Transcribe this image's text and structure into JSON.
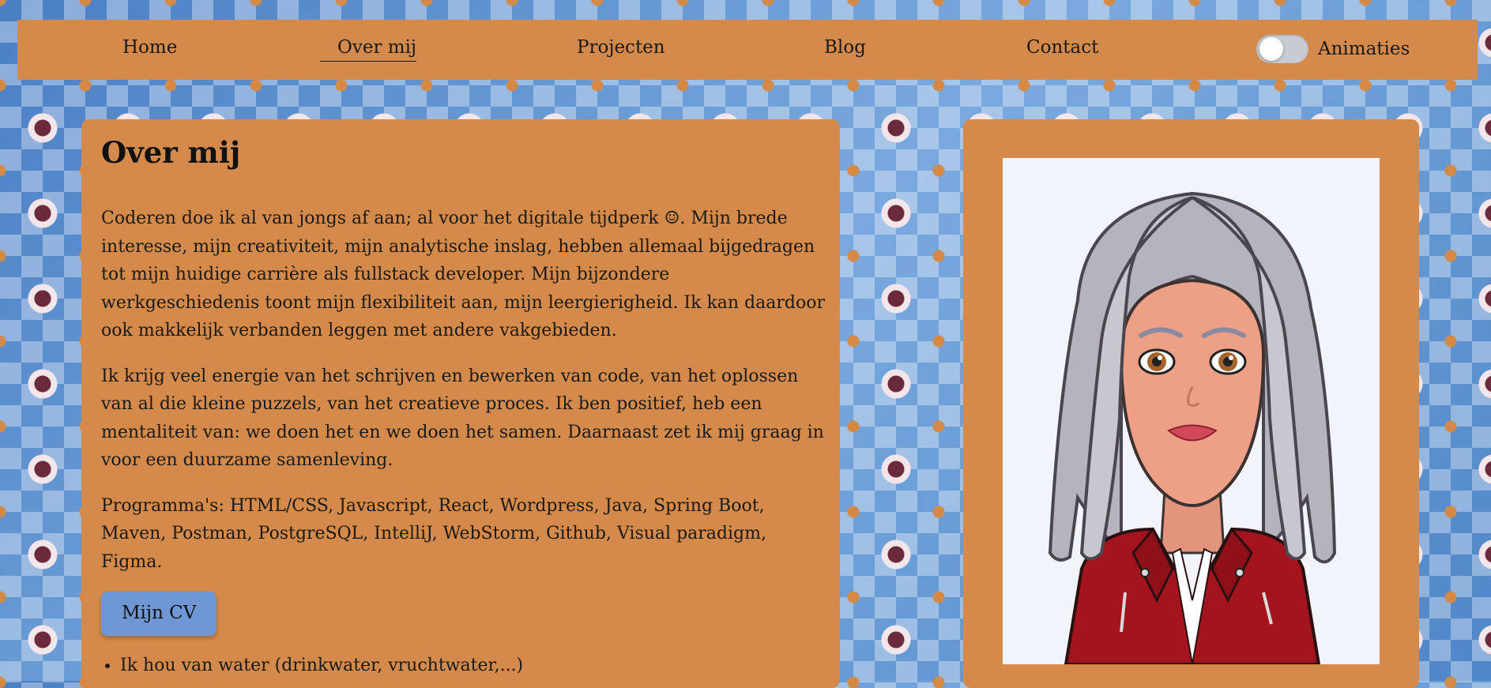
{
  "nav": {
    "items": [
      {
        "label": "Home"
      },
      {
        "label": "Over mij"
      },
      {
        "label": "Projecten"
      },
      {
        "label": "Blog"
      },
      {
        "label": "Contact"
      }
    ],
    "toggle_label": "Animaties",
    "toggle_on": false
  },
  "about": {
    "title": "Over mij",
    "paragraphs": [
      "Coderen doe ik al van jongs af aan; al voor het digitale tijdperk ☺. Mijn brede interesse, mijn creativiteit, mijn analytische inslag, hebben allemaal bijgedragen tot mijn huidige carrière als fullstack developer. Mijn bijzondere werkgeschiedenis toont mijn flexibiliteit aan, mijn leergierigheid. Ik kan daardoor ook makkelijk verbanden leggen met andere vakgebieden.",
      "Ik krijg veel energie van het schrijven en bewerken van code, van het oplossen van al die kleine puzzels, van het creatieve proces. Ik ben positief, heb een mentaliteit van: we doen het en we doen het samen. Daarnaast zet ik mij graag in voor een duurzame samenleving.",
      "Programma's: HTML/CSS, Javascript, React, Wordpress, Java, Spring Boot, Maven, Postman, PostgreSQL, IntelliJ, WebStorm, Github, Visual paradigm, Figma."
    ],
    "cv_button": "Mijn CV",
    "list": [
      "Ik hou van water (drinkwater, vruchtwater,...)"
    ]
  },
  "colors": {
    "card": "#d38a4a",
    "button": "#6f97d4",
    "avatar_bg": "#f2f4fb"
  }
}
